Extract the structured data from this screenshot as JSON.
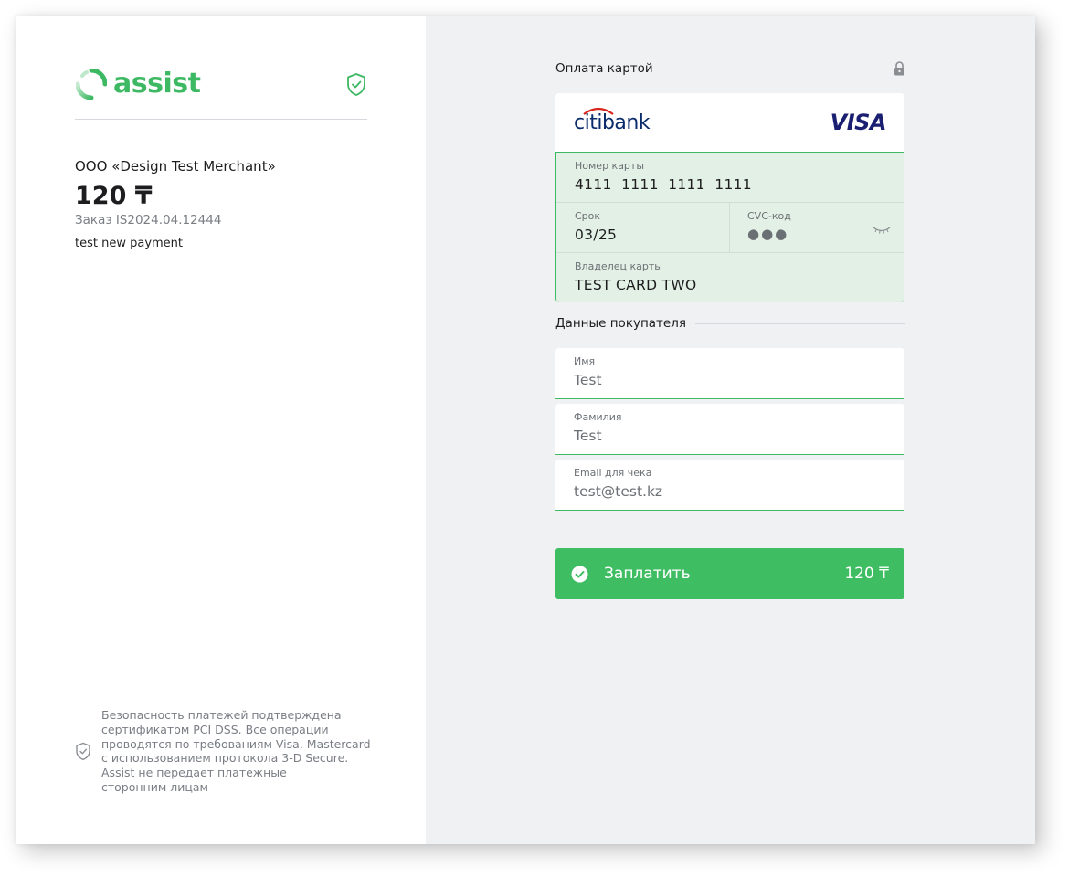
{
  "brand": {
    "name": "assist",
    "color": "#3db863"
  },
  "merchant": {
    "name": "ООО «Design Test Merchant»",
    "amount": "120 ₸",
    "order": "Заказ IS2024.04.12444",
    "description": "test new payment"
  },
  "security_note": "Безопасность платежей подтверждена\nсертификатом PCI DSS. Все операции\nпроводятся по требованиям Visa, Mastercard\nс использованием протокола  3-D Secure.\nAssist не передает платежные\nсторонним лицам",
  "card_section": {
    "title": "Оплата картой",
    "bank": "citibank",
    "network": "VISA",
    "card_number_label": "Номер карты",
    "card_number": "4111  1111  1111  1111",
    "expiry_label": "Срок",
    "expiry": "03/25",
    "cvc_label": "CVC-код",
    "cvc": "●●●",
    "holder_label": "Владелец карты",
    "holder": "TEST CARD TWO"
  },
  "buyer_section": {
    "title": "Данные покупателя",
    "first_name_label": "Имя",
    "first_name": "Test",
    "last_name_label": "Фамилия",
    "last_name": "Test",
    "email_label": "Email для чека",
    "email": "test@test.kz"
  },
  "pay_button": {
    "label": "Заплатить",
    "amount": "120 ₸",
    "color": "#3fbd63"
  },
  "icons": {
    "shield": "shield-check-icon",
    "lock": "lock-icon",
    "eye": "eye-closed-icon",
    "check": "check-circle-icon"
  }
}
